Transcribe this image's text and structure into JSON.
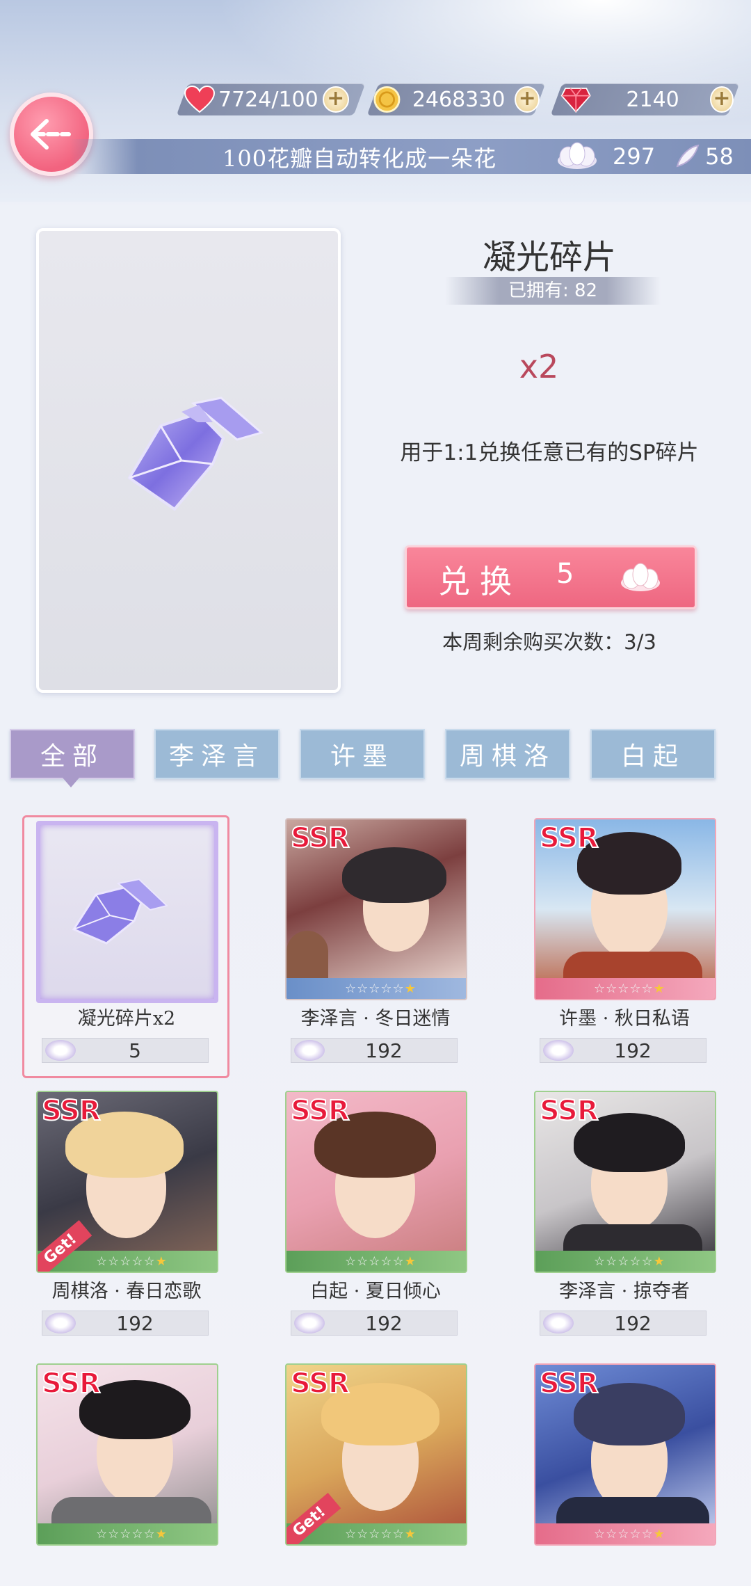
{
  "header": {
    "stamina": "7724/100",
    "gold": "2468330",
    "diamonds": "2140",
    "info_text": "100花瓣自动转化成一朵花",
    "flowers": "297",
    "petals": "58"
  },
  "detail": {
    "title": "凝光碎片",
    "owned": "已拥有: 82",
    "quantity": "x2",
    "description": "用于1:1兑换任意已有的SP碎片",
    "exchange_label": "兑换",
    "exchange_cost": "5",
    "weekly_limit": "本周剩余购买次数：3/3"
  },
  "tabs": [
    {
      "label": "全部",
      "active": true
    },
    {
      "label": "李泽言",
      "active": false
    },
    {
      "label": "许墨",
      "active": false
    },
    {
      "label": "周棋洛",
      "active": false
    },
    {
      "label": "白起",
      "active": false
    }
  ],
  "items": [
    {
      "name": "凝光碎片x2",
      "price": "5",
      "badge": ""
    },
    {
      "name": "李泽言 · 冬日迷情",
      "price": "192",
      "badge": "SSR"
    },
    {
      "name": "许墨 · 秋日私语",
      "price": "192",
      "badge": "SSR"
    },
    {
      "name": "周棋洛 · 春日恋歌",
      "price": "192",
      "badge": "SSR",
      "tag": "Get!"
    },
    {
      "name": "白起 · 夏日倾心",
      "price": "192",
      "badge": "SSR"
    },
    {
      "name": "李泽言 · 掠夺者",
      "price": "192",
      "badge": "SSR"
    },
    {
      "name": "",
      "price": "",
      "badge": "SSR"
    },
    {
      "name": "",
      "price": "",
      "badge": "SSR",
      "tag": "Get!"
    },
    {
      "name": "",
      "price": "",
      "badge": "SSR"
    }
  ],
  "colors": {
    "accent_pink": "#ee6781",
    "tab_blue": "#9cbad6",
    "tab_active": "#a99ac9"
  }
}
